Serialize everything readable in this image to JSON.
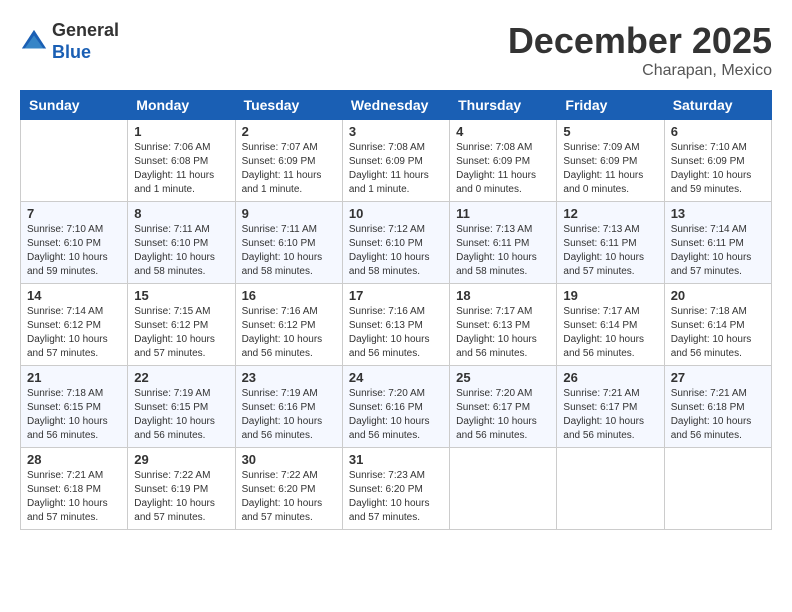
{
  "header": {
    "logo_general": "General",
    "logo_blue": "Blue",
    "month_title": "December 2025",
    "location": "Charapan, Mexico"
  },
  "days_of_week": [
    "Sunday",
    "Monday",
    "Tuesday",
    "Wednesday",
    "Thursday",
    "Friday",
    "Saturday"
  ],
  "weeks": [
    [
      {
        "day": "",
        "info": ""
      },
      {
        "day": "1",
        "info": "Sunrise: 7:06 AM\nSunset: 6:08 PM\nDaylight: 11 hours\nand 1 minute."
      },
      {
        "day": "2",
        "info": "Sunrise: 7:07 AM\nSunset: 6:09 PM\nDaylight: 11 hours\nand 1 minute."
      },
      {
        "day": "3",
        "info": "Sunrise: 7:08 AM\nSunset: 6:09 PM\nDaylight: 11 hours\nand 1 minute."
      },
      {
        "day": "4",
        "info": "Sunrise: 7:08 AM\nSunset: 6:09 PM\nDaylight: 11 hours\nand 0 minutes."
      },
      {
        "day": "5",
        "info": "Sunrise: 7:09 AM\nSunset: 6:09 PM\nDaylight: 11 hours\nand 0 minutes."
      },
      {
        "day": "6",
        "info": "Sunrise: 7:10 AM\nSunset: 6:09 PM\nDaylight: 10 hours\nand 59 minutes."
      }
    ],
    [
      {
        "day": "7",
        "info": ""
      },
      {
        "day": "8",
        "info": "Sunrise: 7:11 AM\nSunset: 6:10 PM\nDaylight: 10 hours\nand 58 minutes."
      },
      {
        "day": "9",
        "info": "Sunrise: 7:11 AM\nSunset: 6:10 PM\nDaylight: 10 hours\nand 58 minutes."
      },
      {
        "day": "10",
        "info": "Sunrise: 7:12 AM\nSunset: 6:10 PM\nDaylight: 10 hours\nand 58 minutes."
      },
      {
        "day": "11",
        "info": "Sunrise: 7:13 AM\nSunset: 6:11 PM\nDaylight: 10 hours\nand 58 minutes."
      },
      {
        "day": "12",
        "info": "Sunrise: 7:13 AM\nSunset: 6:11 PM\nDaylight: 10 hours\nand 57 minutes."
      },
      {
        "day": "13",
        "info": "Sunrise: 7:14 AM\nSunset: 6:11 PM\nDaylight: 10 hours\nand 57 minutes."
      }
    ],
    [
      {
        "day": "14",
        "info": ""
      },
      {
        "day": "15",
        "info": "Sunrise: 7:15 AM\nSunset: 6:12 PM\nDaylight: 10 hours\nand 57 minutes."
      },
      {
        "day": "16",
        "info": "Sunrise: 7:16 AM\nSunset: 6:12 PM\nDaylight: 10 hours\nand 56 minutes."
      },
      {
        "day": "17",
        "info": "Sunrise: 7:16 AM\nSunset: 6:13 PM\nDaylight: 10 hours\nand 56 minutes."
      },
      {
        "day": "18",
        "info": "Sunrise: 7:17 AM\nSunset: 6:13 PM\nDaylight: 10 hours\nand 56 minutes."
      },
      {
        "day": "19",
        "info": "Sunrise: 7:17 AM\nSunset: 6:14 PM\nDaylight: 10 hours\nand 56 minutes."
      },
      {
        "day": "20",
        "info": "Sunrise: 7:18 AM\nSunset: 6:14 PM\nDaylight: 10 hours\nand 56 minutes."
      }
    ],
    [
      {
        "day": "21",
        "info": ""
      },
      {
        "day": "22",
        "info": "Sunrise: 7:19 AM\nSunset: 6:15 PM\nDaylight: 10 hours\nand 56 minutes."
      },
      {
        "day": "23",
        "info": "Sunrise: 7:19 AM\nSunset: 6:16 PM\nDaylight: 10 hours\nand 56 minutes."
      },
      {
        "day": "24",
        "info": "Sunrise: 7:20 AM\nSunset: 6:16 PM\nDaylight: 10 hours\nand 56 minutes."
      },
      {
        "day": "25",
        "info": "Sunrise: 7:20 AM\nSunset: 6:17 PM\nDaylight: 10 hours\nand 56 minutes."
      },
      {
        "day": "26",
        "info": "Sunrise: 7:21 AM\nSunset: 6:17 PM\nDaylight: 10 hours\nand 56 minutes."
      },
      {
        "day": "27",
        "info": "Sunrise: 7:21 AM\nSunset: 6:18 PM\nDaylight: 10 hours\nand 56 minutes."
      }
    ],
    [
      {
        "day": "28",
        "info": "Sunrise: 7:21 AM\nSunset: 6:18 PM\nDaylight: 10 hours\nand 57 minutes."
      },
      {
        "day": "29",
        "info": "Sunrise: 7:22 AM\nSunset: 6:19 PM\nDaylight: 10 hours\nand 57 minutes."
      },
      {
        "day": "30",
        "info": "Sunrise: 7:22 AM\nSunset: 6:20 PM\nDaylight: 10 hours\nand 57 minutes."
      },
      {
        "day": "31",
        "info": "Sunrise: 7:23 AM\nSunset: 6:20 PM\nDaylight: 10 hours\nand 57 minutes."
      },
      {
        "day": "",
        "info": ""
      },
      {
        "day": "",
        "info": ""
      },
      {
        "day": "",
        "info": ""
      }
    ]
  ],
  "week1_day7_info": "Sunrise: 7:10 AM\nSunset: 6:10 PM\nDaylight: 10 hours\nand 59 minutes.",
  "week2_day14_info": "Sunrise: 7:14 AM\nSunset: 6:12 PM\nDaylight: 10 hours\nand 57 minutes.",
  "week3_day21_info": "Sunrise: 7:18 AM\nSunset: 6:15 PM\nDaylight: 10 hours\nand 56 minutes."
}
